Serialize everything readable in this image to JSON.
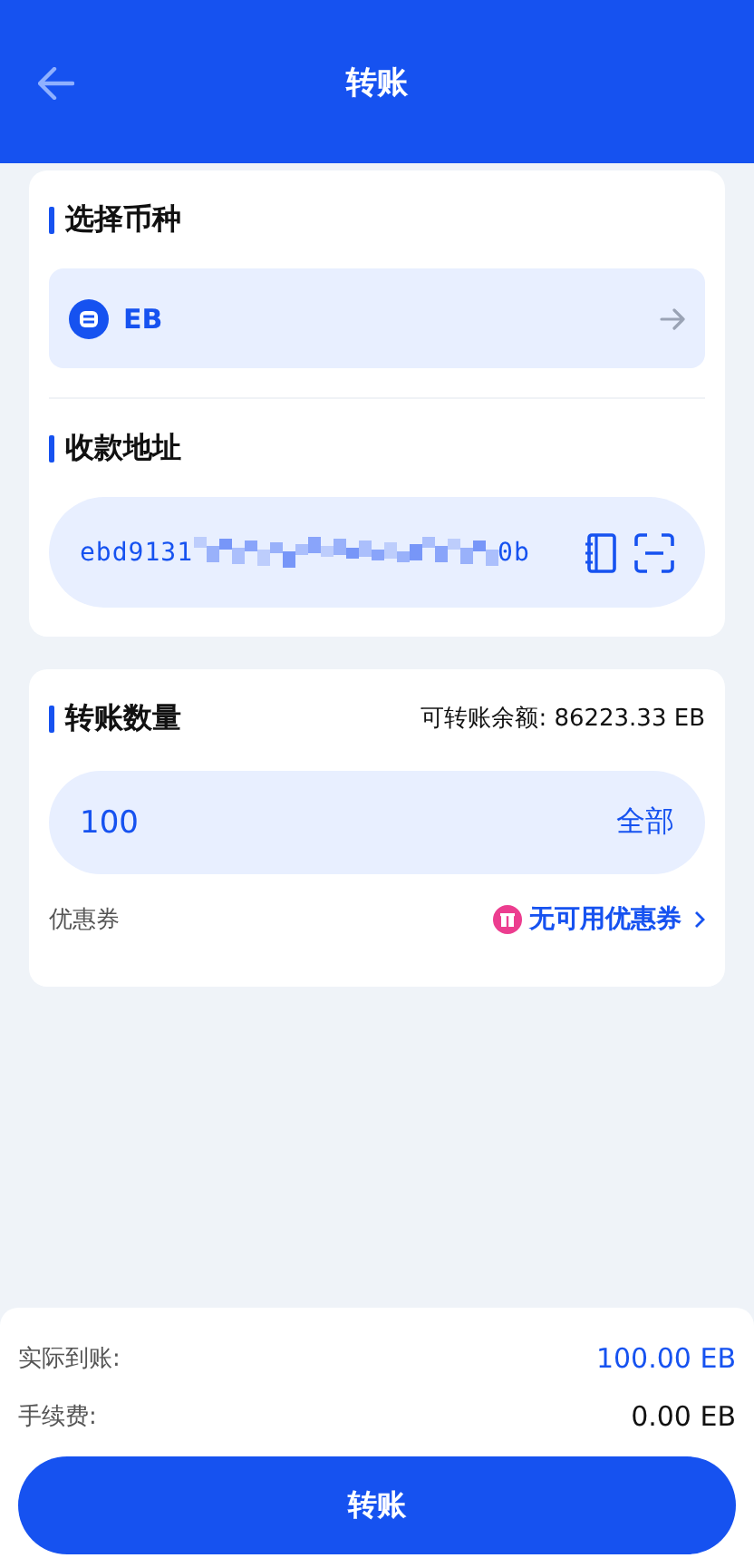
{
  "header": {
    "title": "转账"
  },
  "currency": {
    "heading": "选择币种",
    "symbol": "EB"
  },
  "address": {
    "heading": "收款地址",
    "visible_start": "ebd9131",
    "visible_end": "0b"
  },
  "amount": {
    "heading": "转账数量",
    "balance": "可转账余额: 86223.33 EB",
    "value": "100",
    "all_label": "全部",
    "coupon_label": "优惠券",
    "coupon_value": "无可用优惠券"
  },
  "summary": [
    {
      "label": "实际到账:",
      "value": "100.00 EB",
      "highlight": true
    },
    {
      "label": "手续费:",
      "value": "0.00 EB",
      "highlight": false
    }
  ],
  "submit": "转账"
}
